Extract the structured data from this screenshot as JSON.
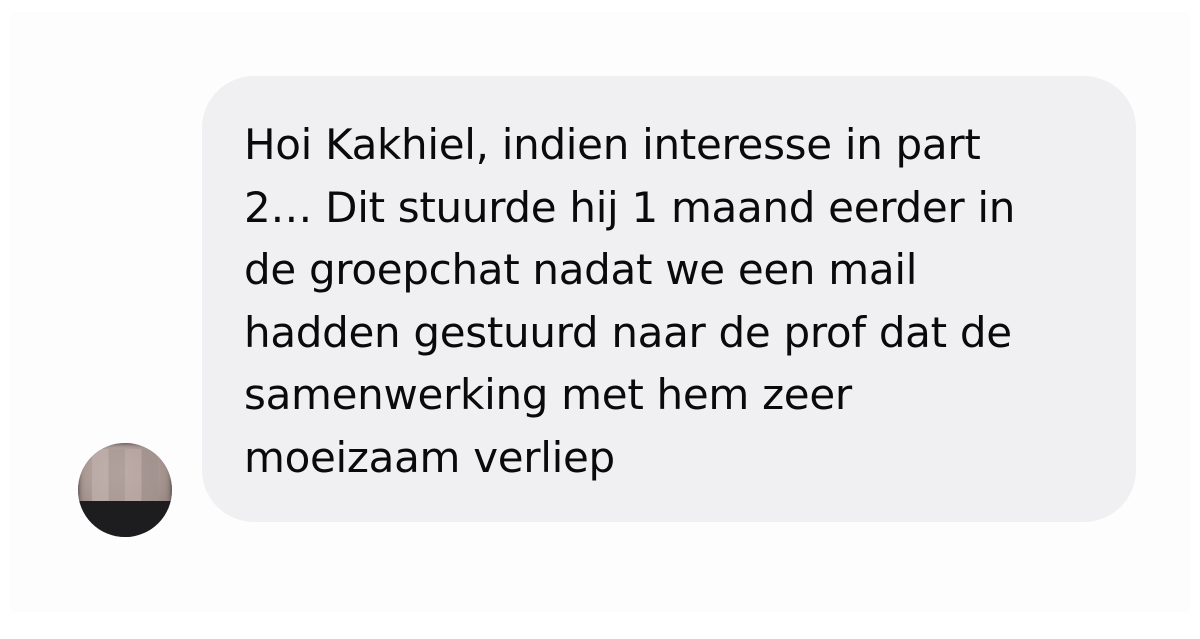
{
  "conversation": {
    "message": {
      "text": "Hoi Kakhiel, indien interesse in part\n2… Dit stuurde hij 1 maand eerder in\nde groepchat nadat we een mail\nhadden gestuurd naar de prof dat de\nsamenwerking met hem zeer\nmoeizaam verliep"
    },
    "sender": {
      "avatar_icon": "person-avatar"
    }
  },
  "colors": {
    "bubble_background": "#f0f0f3",
    "text": "#0a0a0a",
    "page_background": "#ffffff"
  }
}
